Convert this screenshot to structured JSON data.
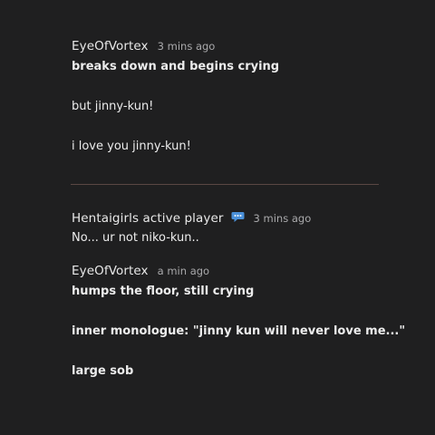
{
  "messages": [
    {
      "author": "EyeOfVortex",
      "time": "3 mins ago",
      "lines": [
        "breaks down and begins crying",
        "but jinny-kun!",
        "i love you jinny-kun!"
      ]
    },
    {
      "author": "Hentaigirls active player",
      "time": "3 mins ago",
      "icon": "chat-bubble-icon",
      "lines": [
        "No... ur not niko-kun.."
      ]
    },
    {
      "author": "EyeOfVortex",
      "time": "a min ago",
      "lines": [
        "humps the floor, still crying",
        "inner monologue: \"jinny kun will never love me...\"",
        "large sob"
      ]
    }
  ],
  "colors": {
    "background": "#1f1f20",
    "text": "#ececec",
    "timestamp": "#a9a9ab",
    "divider": "#5a4743",
    "icon": "#4a90d9"
  }
}
